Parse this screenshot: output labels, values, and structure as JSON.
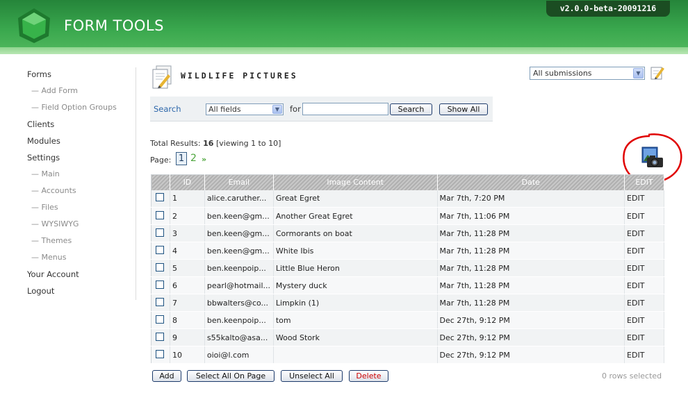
{
  "header": {
    "app_name": "FORM TOOLS",
    "version": "v2.0.0-beta-20091216"
  },
  "sidebar": {
    "items": [
      {
        "label": "Forms",
        "sub": false
      },
      {
        "label": "— Add Form",
        "sub": true
      },
      {
        "label": "— Field Option Groups",
        "sub": true
      },
      {
        "label": "Clients",
        "sub": false
      },
      {
        "label": "Modules",
        "sub": false
      },
      {
        "label": "Settings",
        "sub": false
      },
      {
        "label": "— Main",
        "sub": true
      },
      {
        "label": "— Accounts",
        "sub": true
      },
      {
        "label": "— Files",
        "sub": true
      },
      {
        "label": "— WYSIWYG",
        "sub": true
      },
      {
        "label": "— Themes",
        "sub": true
      },
      {
        "label": "— Menus",
        "sub": true
      },
      {
        "label": "Your Account",
        "sub": false
      },
      {
        "label": "Logout",
        "sub": false
      }
    ]
  },
  "page": {
    "title": "WILDLIFE PICTURES",
    "view_selected": "All submissions"
  },
  "search": {
    "label": "Search",
    "field_selected": "All fields",
    "for_label": "for",
    "query": "",
    "search_button": "Search",
    "show_all_button": "Show All"
  },
  "results": {
    "total_label": "Total Results:",
    "total": "16",
    "viewing": "[viewing 1 to 10]",
    "page_label": "Page:",
    "pages": [
      "1",
      "2"
    ],
    "next": "»"
  },
  "table": {
    "columns": [
      "",
      "ID",
      "Email",
      "Image Content",
      "Date",
      "EDIT"
    ],
    "rows": [
      {
        "id": "1",
        "email": "alice.caruther...",
        "content": "Great Egret",
        "date": "Mar 7th, 7:20 PM",
        "action": "EDIT"
      },
      {
        "id": "2",
        "email": "ben.keen@gm...",
        "content": "Another Great Egret",
        "date": "Mar 7th, 11:06 PM",
        "action": "EDIT"
      },
      {
        "id": "3",
        "email": "ben.keen@gm...",
        "content": "Cormorants on boat",
        "date": "Mar 7th, 11:28 PM",
        "action": "EDIT"
      },
      {
        "id": "4",
        "email": "ben.keen@gm...",
        "content": "White Ibis",
        "date": "Mar 7th, 11:28 PM",
        "action": "EDIT"
      },
      {
        "id": "5",
        "email": "ben.keenpoip...",
        "content": "Little Blue Heron",
        "date": "Mar 7th, 11:28 PM",
        "action": "EDIT"
      },
      {
        "id": "6",
        "email": "pearl@hotmail...",
        "content": "Mystery duck",
        "date": "Mar 7th, 11:28 PM",
        "action": "EDIT"
      },
      {
        "id": "7",
        "email": "bbwalters@co...",
        "content": "Limpkin (1)",
        "date": "Mar 7th, 11:28 PM",
        "action": "EDIT"
      },
      {
        "id": "8",
        "email": "ben.keenpoip...",
        "content": "tom",
        "date": "Dec 27th, 9:12 PM",
        "action": "EDIT"
      },
      {
        "id": "9",
        "email": "s55kalto@asa...",
        "content": "Wood Stork",
        "date": "Dec 27th, 9:12 PM",
        "action": "EDIT"
      },
      {
        "id": "10",
        "email": "oioi@l.com",
        "content": "",
        "date": "Dec 27th, 9:12 PM",
        "action": "EDIT"
      }
    ]
  },
  "footer": {
    "add": "Add",
    "select_all": "Select All On Page",
    "unselect_all": "Unselect All",
    "delete": "Delete",
    "rows_selected": "0 rows selected"
  },
  "colors": {
    "header_green": "#3aa84e",
    "link_green": "#3b8e2d",
    "delete_red": "#cc0000",
    "annotation_red": "#e00000"
  },
  "icons": [
    "formtools-logo-icon",
    "form-document-icon",
    "edit-view-icon",
    "camera-icon",
    "dropdown-arrow-icon"
  ]
}
